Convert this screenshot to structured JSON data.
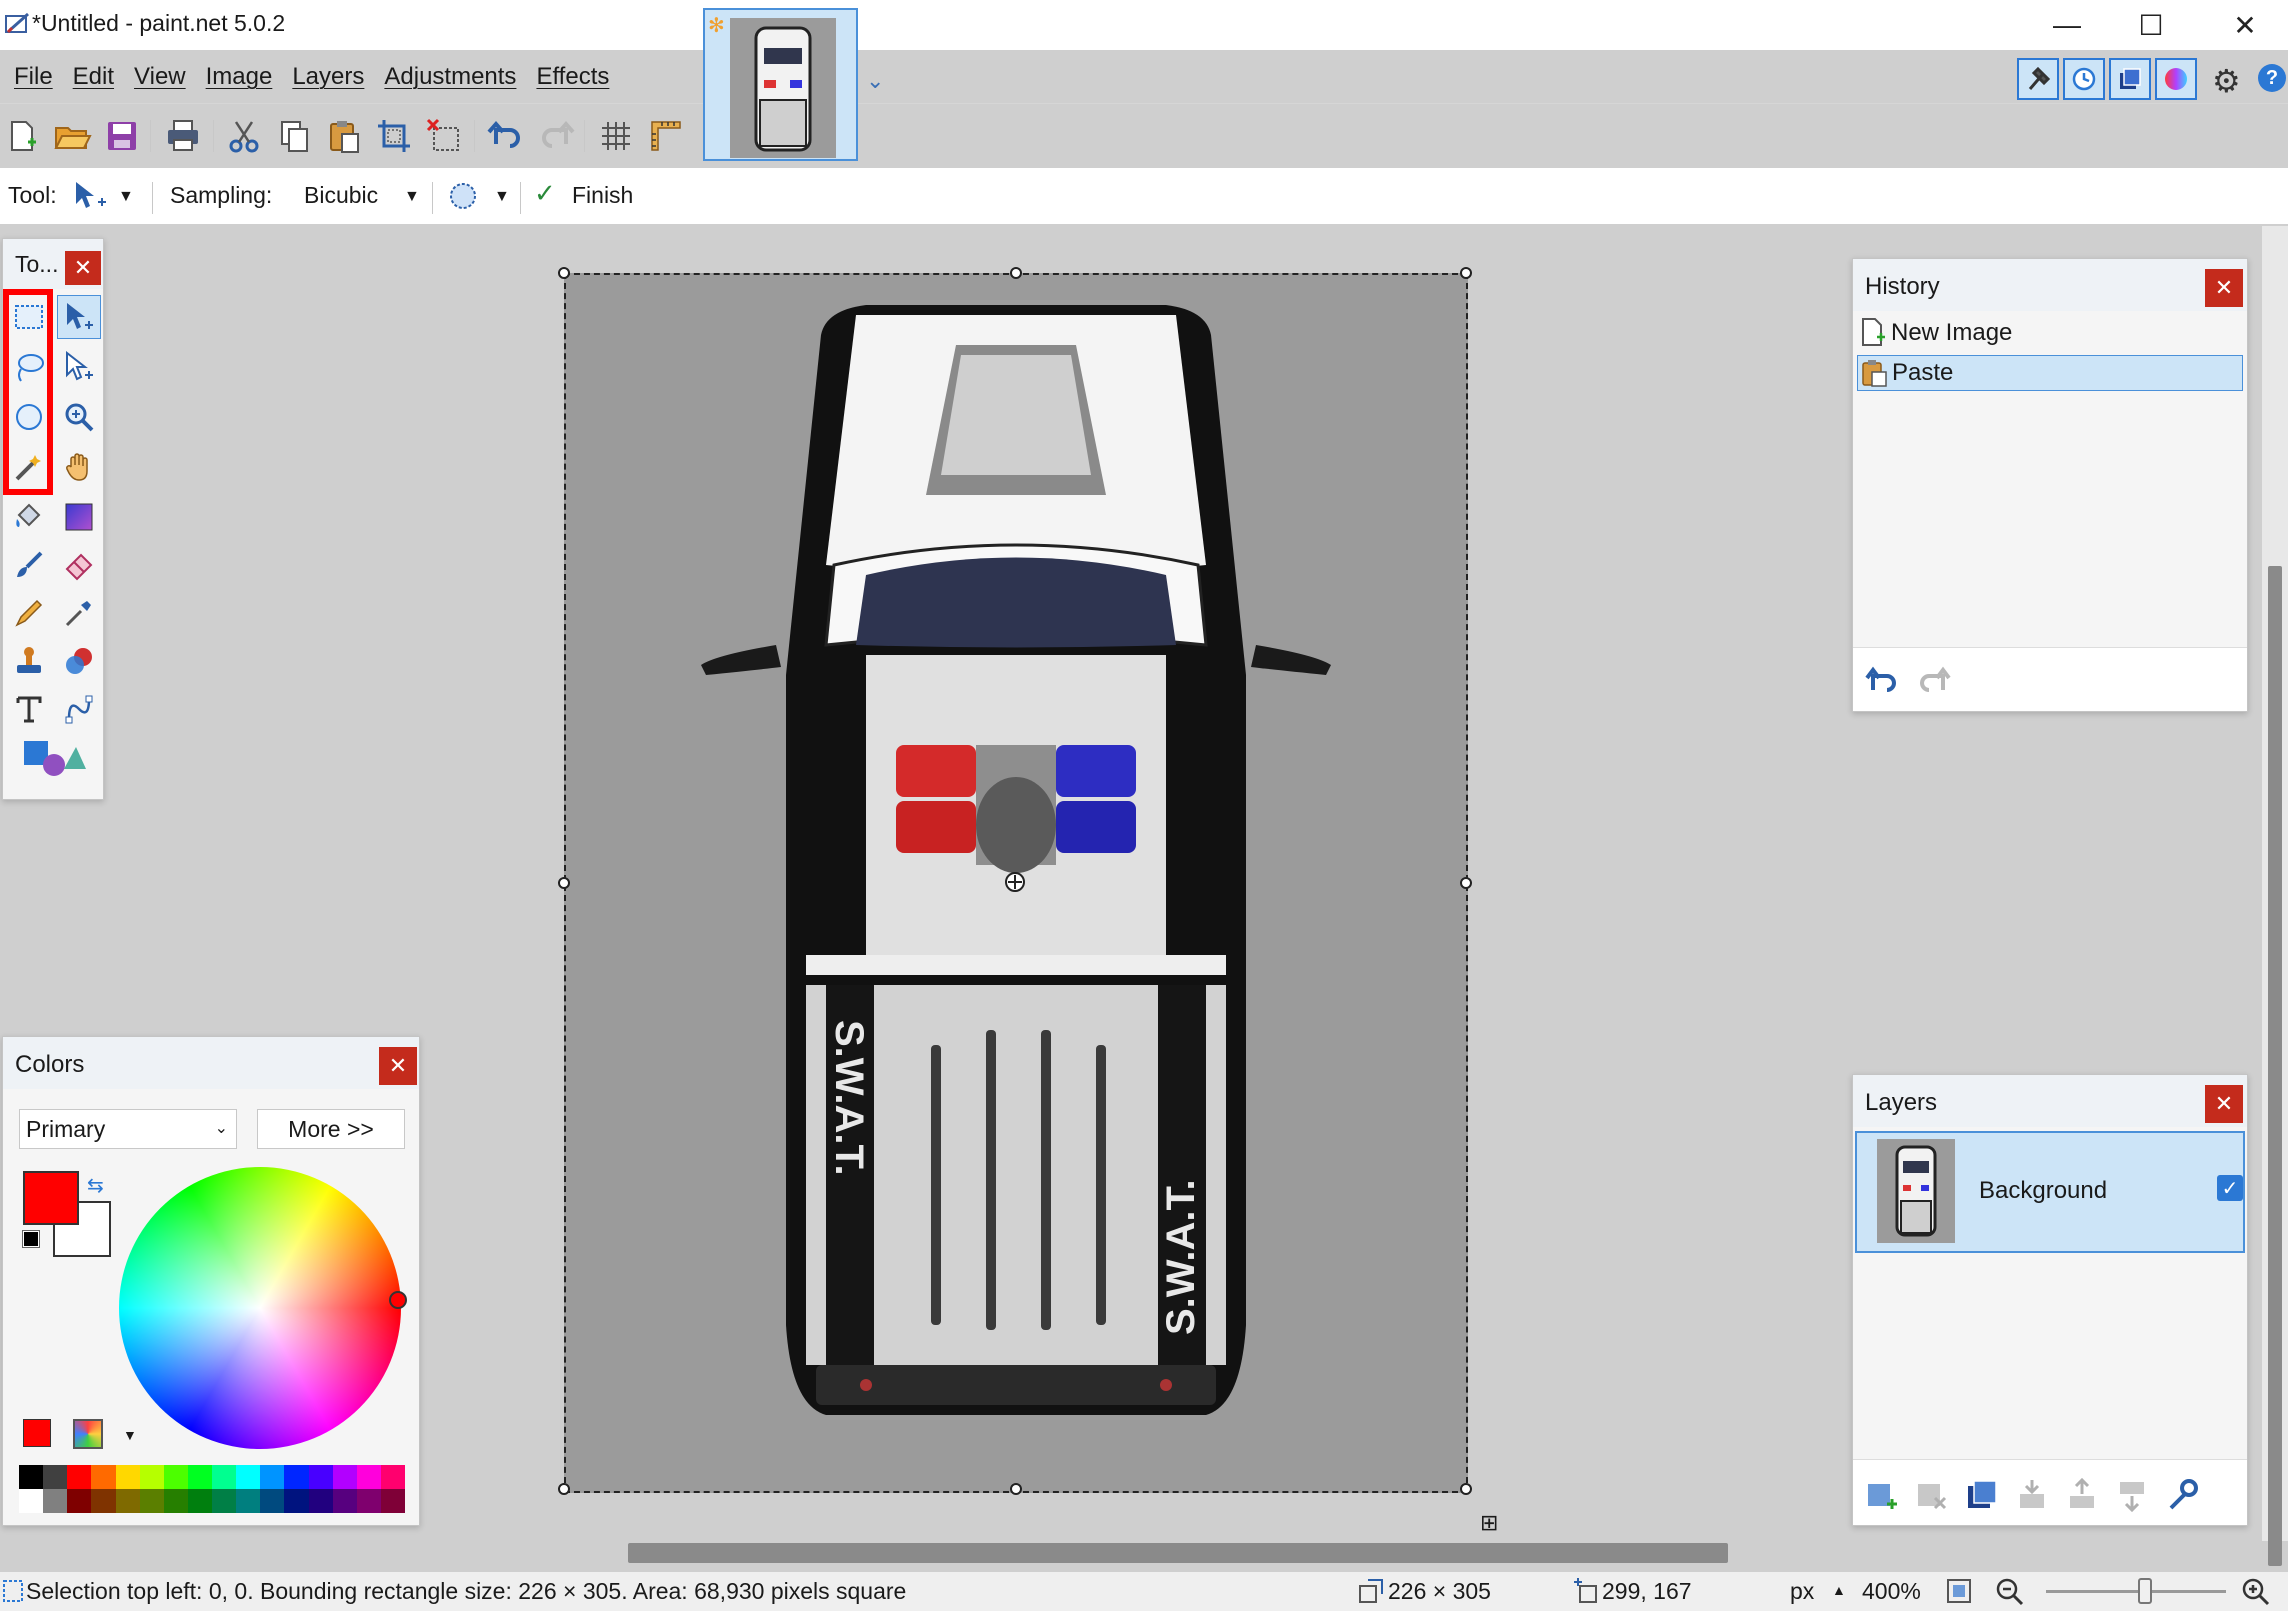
{
  "window": {
    "title": "*Untitled - paint.net 5.0.2",
    "minimize_glyph": "—",
    "maximize_glyph": "☐",
    "close_glyph": "✕"
  },
  "menu": [
    "File",
    "Edit",
    "View",
    "Image",
    "Layers",
    "Adjustments",
    "Effects"
  ],
  "toolbar_icons": [
    "new-icon",
    "open-icon",
    "save-icon",
    "print-icon",
    "cut-icon",
    "copy-icon",
    "paste-icon",
    "crop-to-selection-icon",
    "deselect-icon",
    "undo-icon",
    "redo-icon",
    "grid-icon",
    "rulers-icon"
  ],
  "panel_toggles": [
    "tools-toggle-icon",
    "history-toggle-icon",
    "layers-toggle-icon",
    "colors-toggle-icon"
  ],
  "tool_options": {
    "tool_label": "Tool:",
    "sampling_label": "Sampling:",
    "sampling_value": "Bicubic",
    "finish_label": "Finish"
  },
  "tools_panel": {
    "title": "To...",
    "tools": [
      "rectangle-select-icon",
      "move-selected-pixels-icon",
      "lasso-select-icon",
      "move-selection-icon",
      "ellipse-select-icon",
      "zoom-icon",
      "magic-wand-icon",
      "pan-icon",
      "paint-bucket-icon",
      "gradient-icon",
      "paintbrush-icon",
      "eraser-icon",
      "pencil-icon",
      "color-picker-icon",
      "clone-stamp-icon",
      "recolor-icon",
      "text-icon",
      "line-curve-icon",
      "shapes-icon"
    ]
  },
  "history": {
    "title": "History",
    "items": [
      {
        "label": "New Image",
        "selected": false
      },
      {
        "label": "Paste",
        "selected": true
      }
    ]
  },
  "layers": {
    "title": "Layers",
    "items": [
      {
        "name": "Background",
        "visible": true
      }
    ]
  },
  "colors": {
    "title": "Colors",
    "mode": "Primary",
    "more_label": "More >>",
    "primary": "#ff0000",
    "secondary": "#ffffff",
    "palette": [
      "#000000",
      "#404040",
      "#ff0000",
      "#ff6a00",
      "#ffd800",
      "#b6ff00",
      "#4cff00",
      "#00ff21",
      "#00ff90",
      "#00ffff",
      "#0094ff",
      "#0026ff",
      "#4800ff",
      "#b200ff",
      "#ff00dc",
      "#ff006e",
      "#ffffff",
      "#808080",
      "#7f0000",
      "#7f3300",
      "#7f6a00",
      "#5b7f00",
      "#267f00",
      "#007f0e",
      "#007f46",
      "#007f7f",
      "#004a7f",
      "#00137f",
      "#21007f",
      "#57007f",
      "#7f006e",
      "#7f0037"
    ]
  },
  "status": {
    "selection_info": "Selection top left: 0, 0. Bounding rectangle size: 226 × 305. Area: 68,930 pixels square",
    "image_size": "226 × 305",
    "cursor_pos": "299, 167",
    "unit": "px",
    "zoom": "400%"
  },
  "canvas_image": {
    "left_text": "S.W.A.T.",
    "right_text": "S.W.A.T."
  }
}
